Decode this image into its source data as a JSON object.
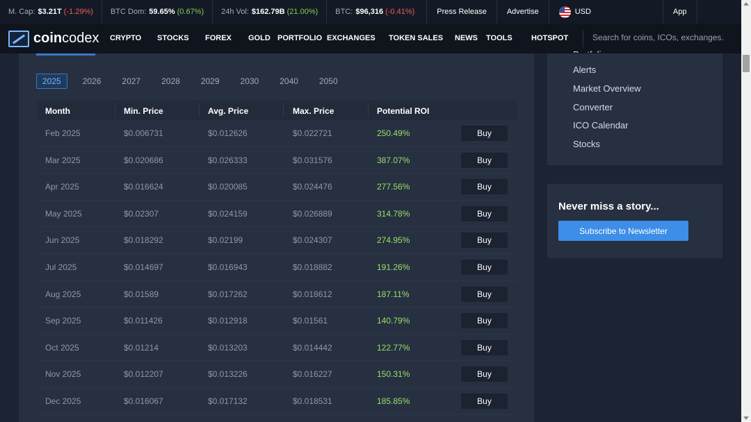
{
  "ticker": {
    "mcap_label": "M. Cap:",
    "mcap_value": "$3.21T",
    "mcap_change": "(-1.29%)",
    "dom_label": "BTC Dom:",
    "dom_value": "59.65%",
    "dom_change": "(0.67%)",
    "vol_label": "24h Vol:",
    "vol_value": "$162.79B",
    "vol_change": "(21.00%)",
    "btc_label": "BTC:",
    "btc_value": "$96,316",
    "btc_change": "(-0.41%)",
    "press_release": "Press Release",
    "advertise": "Advertise",
    "currency": "USD",
    "app": "App"
  },
  "nav": {
    "logo_bold": "coin",
    "logo_rest": "codex",
    "items": [
      "CRYPTO",
      "STOCKS",
      "FOREX",
      "GOLD",
      "PORTFOLIO",
      "EXCHANGES",
      "TOKEN SALES",
      "NEWS",
      "TOOLS",
      "HOTSPOT"
    ],
    "search_placeholder": "Search for coins, ICOs, exchanges..."
  },
  "years": [
    "2025",
    "2026",
    "2027",
    "2028",
    "2029",
    "2030",
    "2040",
    "2050"
  ],
  "active_year": "2025",
  "table": {
    "headers": [
      "Month",
      "Min. Price",
      "Avg. Price",
      "Max. Price",
      "Potential ROI"
    ],
    "buy_label": "Buy",
    "rows": [
      [
        "Feb 2025",
        "$0.006731",
        "$0.012626",
        "$0.022721",
        "250.49%"
      ],
      [
        "Mar 2025",
        "$0.020686",
        "$0.026333",
        "$0.031576",
        "387.07%"
      ],
      [
        "Apr 2025",
        "$0.016624",
        "$0.020085",
        "$0.024476",
        "277.56%"
      ],
      [
        "May 2025",
        "$0.02307",
        "$0.024159",
        "$0.026889",
        "314.78%"
      ],
      [
        "Jun 2025",
        "$0.018292",
        "$0.02199",
        "$0.024307",
        "274.95%"
      ],
      [
        "Jul 2025",
        "$0.014697",
        "$0.016943",
        "$0.018882",
        "191.26%"
      ],
      [
        "Aug 2025",
        "$0.01589",
        "$0.017262",
        "$0.018612",
        "187.11%"
      ],
      [
        "Sep 2025",
        "$0.011426",
        "$0.012918",
        "$0.01561",
        "140.79%"
      ],
      [
        "Oct 2025",
        "$0.01214",
        "$0.013203",
        "$0.014442",
        "122.77%"
      ],
      [
        "Nov 2025",
        "$0.012207",
        "$0.013226",
        "$0.016227",
        "150.31%"
      ],
      [
        "Dec 2025",
        "$0.016067",
        "$0.017132",
        "$0.018531",
        "185.85%"
      ]
    ]
  },
  "sidebar": {
    "cut_item": "Portfolio",
    "items": [
      "Alerts",
      "Market Overview",
      "Converter",
      "ICO Calendar",
      "Stocks"
    ]
  },
  "newsletter": {
    "title": "Never miss a story...",
    "button": "Subscribe to Newsletter"
  },
  "colors": {
    "positive": "#9be06a",
    "negative": "#ef5b5b",
    "accent": "#3d8ee8"
  }
}
